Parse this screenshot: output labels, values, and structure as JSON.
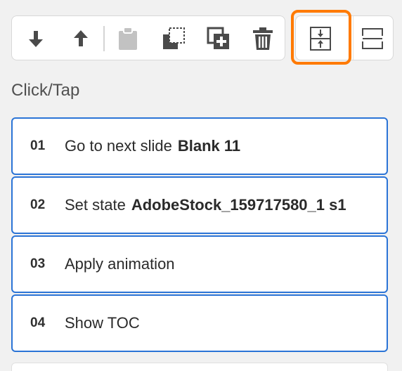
{
  "toolbar": {
    "buttons": [
      {
        "name": "move-down",
        "icon": "arrow-down-icon"
      },
      {
        "name": "move-up",
        "icon": "arrow-up-icon"
      },
      {
        "name": "paste",
        "icon": "clipboard-icon",
        "disabled": true
      },
      {
        "name": "copy",
        "icon": "copy-icon"
      },
      {
        "name": "duplicate",
        "icon": "duplicate-add-icon"
      },
      {
        "name": "delete",
        "icon": "trash-icon"
      },
      {
        "name": "collapse",
        "icon": "collapse-rows-icon",
        "highlighted": true
      },
      {
        "name": "expand",
        "icon": "expand-rows-icon"
      }
    ],
    "highlight_color": "#ff7a00"
  },
  "section": {
    "title": "Click/Tap"
  },
  "actions": [
    {
      "num": "01",
      "text": "Go to next slide",
      "target": "Blank 11"
    },
    {
      "num": "02",
      "text": "Set state",
      "target": "AdobeStock_159717580_1 s1"
    },
    {
      "num": "03",
      "text": "Apply animation",
      "target": ""
    },
    {
      "num": "04",
      "text": "Show TOC",
      "target": ""
    }
  ],
  "colors": {
    "accent_border": "#2b74d6",
    "icon_active": "#4a4a4a",
    "icon_disabled": "#bdbdbd"
  }
}
